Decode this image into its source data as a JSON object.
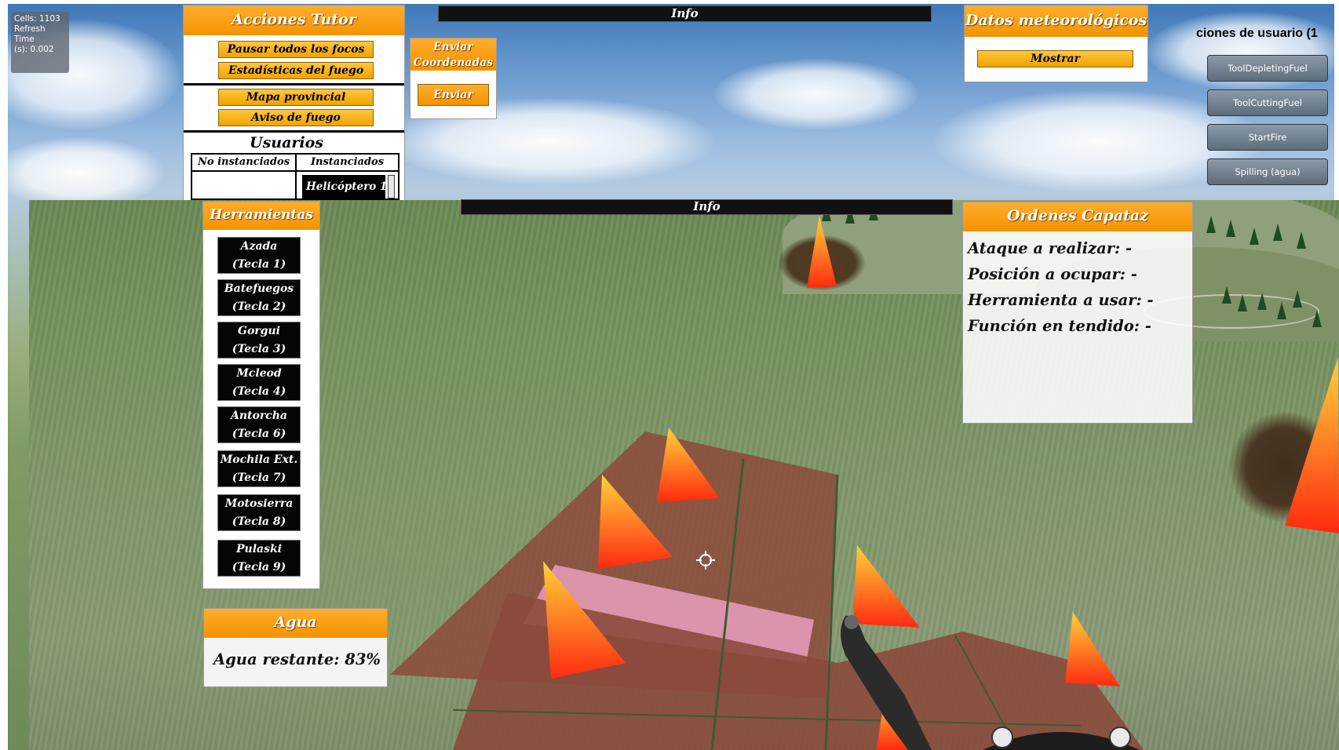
{
  "stats": {
    "cells": "Cells: 1103",
    "refresh_line1": "Refresh Time",
    "refresh_line2": "(s): 0.002"
  },
  "tutor_panel": {
    "title": "Acciones Tutor",
    "buttons": [
      "Pausar todos los focos",
      "Estadísticas del fuego",
      "Mapa provincial",
      "Aviso de fuego"
    ],
    "users_title": "Usuarios",
    "col_not_instanced": "No instanciados",
    "col_instanced": "Instanciados",
    "instanced_items": [
      "Helicóptero 1"
    ]
  },
  "coords_panel": {
    "title_line1": "Enviar",
    "title_line2": "Coordenadas",
    "send_label": "Enviar"
  },
  "top_info": {
    "label": "Info"
  },
  "weather_panel": {
    "title": "Datos meteorológicos",
    "show_label": "Mostrar"
  },
  "user_actions": {
    "title": "ciones de usuario (1",
    "items": [
      "ToolDepletingFuel",
      "ToolCuttingFuel",
      "StartFire",
      "Spilling (agua)"
    ]
  },
  "ground_info": {
    "label": "Info"
  },
  "tools_panel": {
    "title": "Herramientas",
    "tools": [
      {
        "name": "Azada",
        "key": "(Tecla 1)"
      },
      {
        "name": "Batefuegos",
        "key": "(Tecla 2)"
      },
      {
        "name": "Gorgui",
        "key": "(Tecla 3)"
      },
      {
        "name": "Mcleod",
        "key": "(Tecla 4)"
      },
      {
        "name": "Antorcha",
        "key": "(Tecla 6)"
      },
      {
        "name": "Mochila Ext.",
        "key": "(Tecla 7)"
      },
      {
        "name": "Motosierra",
        "key": "(Tecla 8)"
      },
      {
        "name": "Pulaski",
        "key": "(Tecla 9)"
      }
    ]
  },
  "water_panel": {
    "title": "Agua",
    "remaining": "Agua restante: 83%",
    "remaining_fraction": 0.83
  },
  "orders_panel": {
    "title": "Ordenes Capataz",
    "lines": [
      "Ataque a realizar: -",
      "Posición a ocupar: -",
      "Herramienta a usar: -",
      "Función en tendido: -"
    ]
  },
  "colors": {
    "orange_header": "#f39300",
    "button_yellow": "#f0a300",
    "info_bar": "#111111",
    "gray_button": "#5e6d7a",
    "fire": "#ff3a10"
  },
  "icons": [
    "crosshair-icon",
    "fire-cone-icon",
    "hose-nozzle-icon"
  ]
}
